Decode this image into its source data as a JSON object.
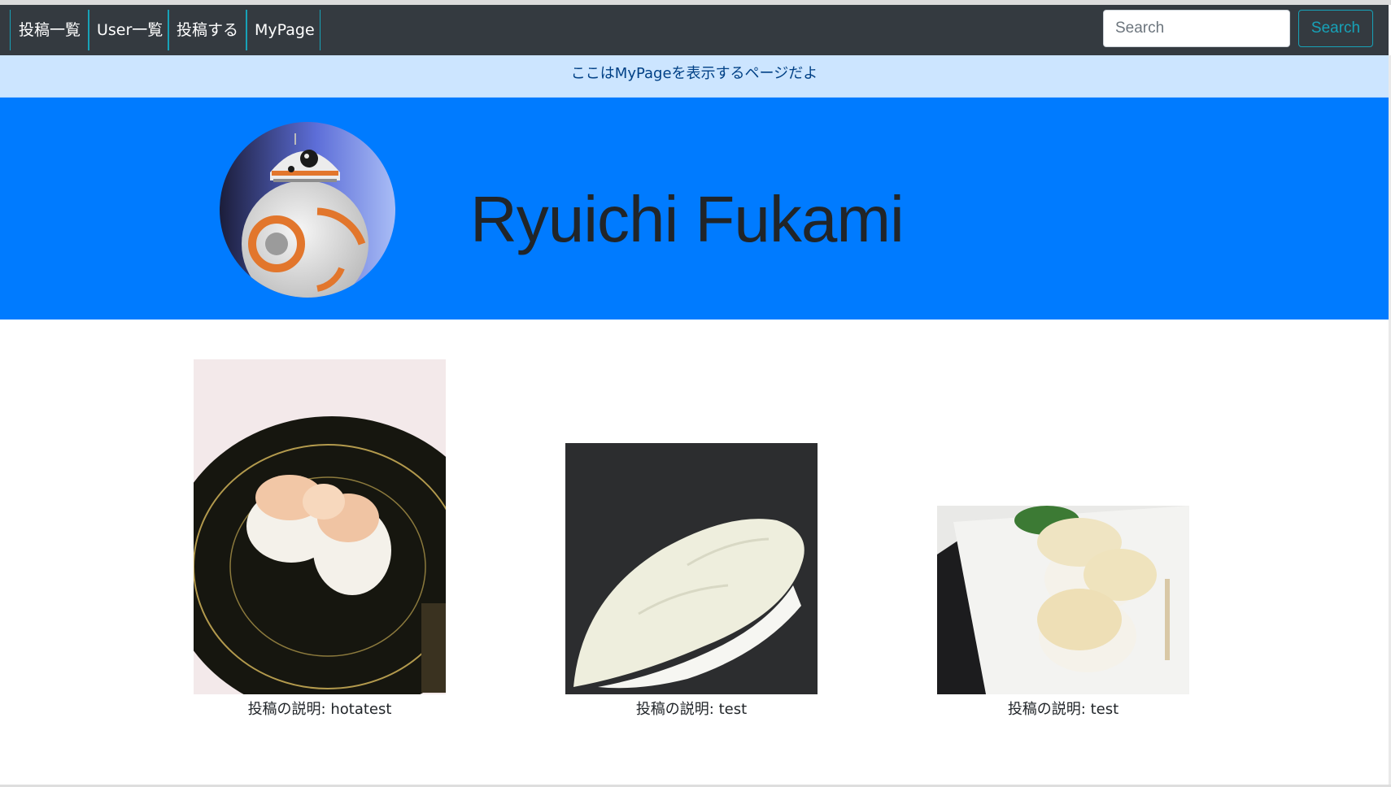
{
  "navbar": {
    "links": [
      {
        "label": "投稿一覧"
      },
      {
        "label": "User一覧"
      },
      {
        "label": "投稿する"
      },
      {
        "label": "MyPage"
      }
    ],
    "search_placeholder": "Search",
    "search_button": "Search"
  },
  "alert": {
    "message": "ここはMyPageを表示するページだよ"
  },
  "profile": {
    "name": "Ryuichi Fukami",
    "avatar_icon": "bb8-robot-avatar"
  },
  "posts": [
    {
      "caption": "投稿の説明: hotatest",
      "image": "scallop-sushi-on-black-plate"
    },
    {
      "caption": "投稿の説明: test",
      "image": "scallop-nigiri-on-dark-background"
    },
    {
      "caption": "投稿の説明: test",
      "image": "scallop-sushi-on-white-plate"
    }
  ],
  "colors": {
    "navbar_bg": "#343a40",
    "nav_accent": "#17a2b8",
    "alert_bg": "#cce5ff",
    "alert_text": "#004085",
    "hero_bg": "#007bff"
  }
}
